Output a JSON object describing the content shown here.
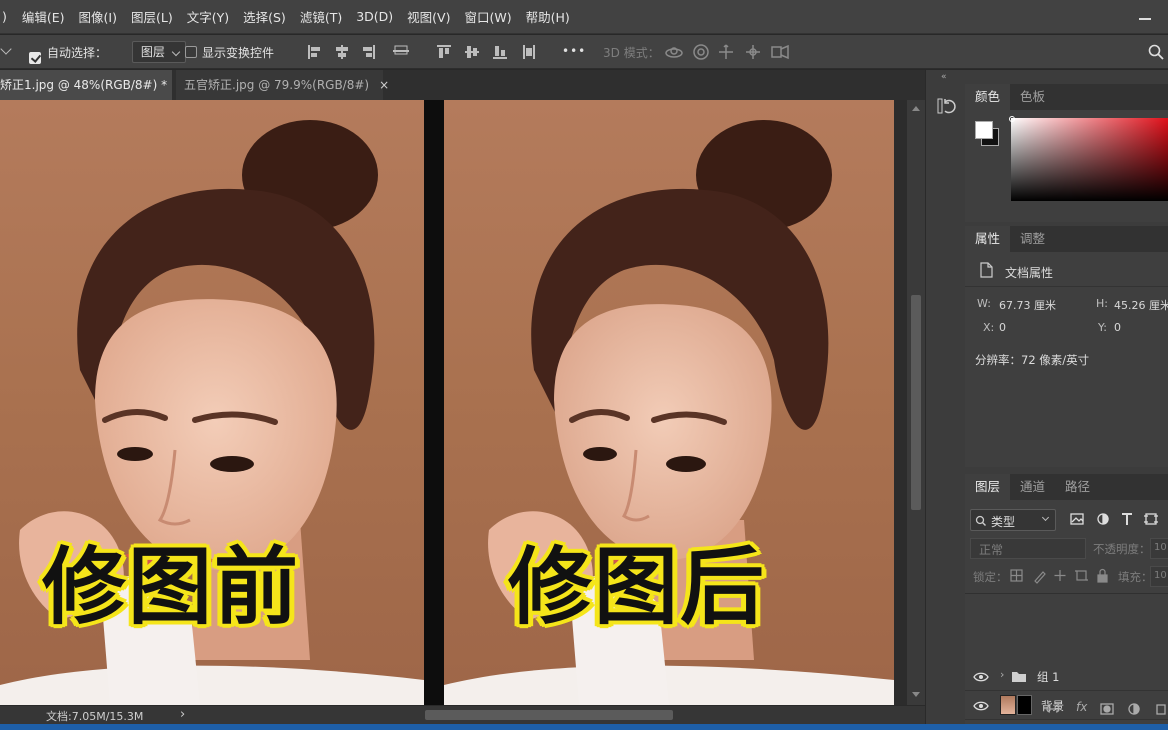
{
  "menu": [
    "图像(I)",
    "图层(L)",
    "文字(Y)",
    "选择(S)",
    "滤镜(T)",
    "3D(D)",
    "视图(V)",
    "窗口(W)",
    "帮助(H)"
  ],
  "menu_partial_left": ")",
  "menu_edit": "编辑(E)",
  "options": {
    "auto_select_label": "自动选择：",
    "auto_select_value": "图层",
    "show_transform_label": "显示变换控件",
    "more": "•••",
    "mode_3d": "3D 模式："
  },
  "tabs": [
    {
      "label": "矫正1.jpg @ 48%(RGB/8#) *",
      "close": "×"
    },
    {
      "label": "五官矫正.jpg @ 79.9%(RGB/8#)",
      "close": "×"
    }
  ],
  "captions": {
    "before": "修图前",
    "after": "修图后"
  },
  "status": {
    "doc": "文档:7.05M/15.3M",
    "arrow": "›"
  },
  "color_panel": {
    "tabs": [
      "颜色",
      "色板"
    ]
  },
  "properties_panel": {
    "tabs": [
      "属性",
      "调整"
    ],
    "title": "文档属性",
    "w_label": "W:",
    "w_value": "67.73 厘米",
    "h_label": "H:",
    "h_value": "45.26 厘米",
    "x_label": "X:",
    "x_value": "0",
    "y_label": "Y:",
    "y_value": "0",
    "resolution": "分辨率：72 像素/英寸"
  },
  "layers_panel": {
    "tabs": [
      "图层",
      "通道",
      "路径"
    ],
    "filter_kind": "类型",
    "blend_mode": "正常",
    "opacity_label": "不透明度：",
    "opacity_value": "10",
    "lock_label": "锁定：",
    "fill_label": "填充：",
    "fill_value": "10",
    "layers": [
      {
        "name": "组 1",
        "kind": "group"
      },
      {
        "name": "背景",
        "kind": "image"
      }
    ],
    "footer_fx": "fx"
  }
}
